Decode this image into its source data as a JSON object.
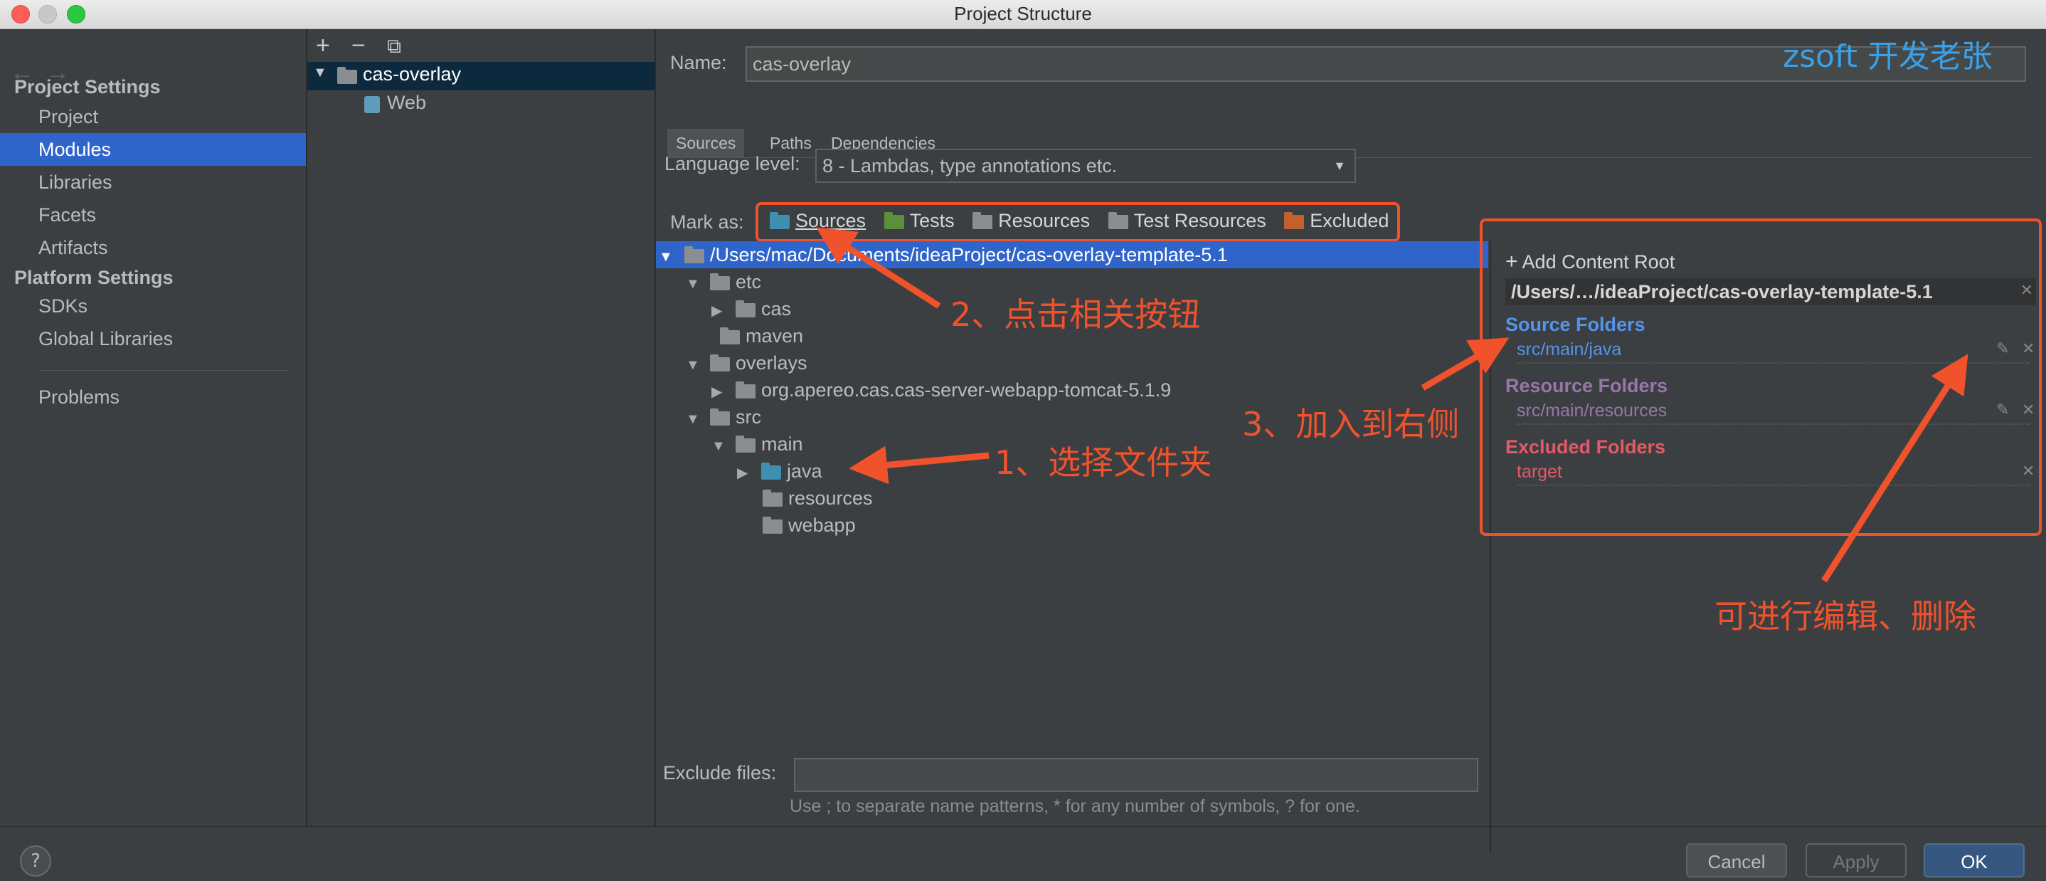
{
  "window": {
    "title": "Project Structure"
  },
  "nav": {
    "back": "←",
    "forward": "→"
  },
  "sidebar": {
    "project_settings": "Project Settings",
    "project_items": [
      "Project",
      "Modules",
      "Libraries",
      "Facets",
      "Artifacts"
    ],
    "platform_settings": "Platform Settings",
    "platform_items": [
      "SDKs",
      "Global Libraries"
    ],
    "problems": "Problems"
  },
  "modules": {
    "add": "+",
    "remove": "−",
    "copy": "⧉",
    "tree": [
      {
        "label": "cas-overlay"
      },
      {
        "label": "Web"
      }
    ]
  },
  "name": {
    "label": "Name:",
    "value": "cas-overlay"
  },
  "watermark": "zsoft 开发老张",
  "tabs": [
    "Sources",
    "Paths",
    "Dependencies"
  ],
  "language": {
    "label": "Language level:",
    "value": "8 - Lambdas, type annotations etc."
  },
  "mark_as": {
    "label": "Mark as:",
    "buttons": [
      {
        "label": "Sources",
        "color": "#3e8fb0"
      },
      {
        "label": "Tests",
        "color": "#5a8f3c"
      },
      {
        "label": "Resources",
        "color": "#8b8e90"
      },
      {
        "label": "Test Resources",
        "color": "#8b8e90"
      },
      {
        "label": "Excluded",
        "color": "#c2612e"
      }
    ]
  },
  "tree": {
    "root": "/Users/mac/Documents/ideaProject/cas-overlay-template-5.1",
    "nodes": [
      "etc",
      "cas",
      "maven",
      "overlays",
      "org.apereo.cas.cas-server-webapp-tomcat-5.1.9",
      "src",
      "main",
      "java",
      "resources",
      "webapp"
    ]
  },
  "content_root": {
    "add_label": "Add Content Root",
    "path": "/Users/…/ideaProject/cas-overlay-template-5.1",
    "source_title": "Source Folders",
    "source_path": "src/main/java",
    "resource_title": "Resource Folders",
    "resource_path": "src/main/resources",
    "excluded_title": "Excluded Folders",
    "excluded_path": "target",
    "colors": {
      "source": "#5394ec",
      "resource": "#9876aa",
      "excluded": "#e25a6a"
    }
  },
  "exclude": {
    "label": "Exclude files:",
    "hint": "Use ; to separate name patterns, * for any number of symbols, ? for one."
  },
  "annotations": {
    "step1": "1、选择文件夹",
    "step2": "2、点击相关按钮",
    "step3": "3、加入到右侧",
    "edit_delete": "可进行编辑、删除"
  },
  "footer": {
    "help": "?",
    "cancel": "Cancel",
    "apply": "Apply",
    "ok": "OK"
  }
}
